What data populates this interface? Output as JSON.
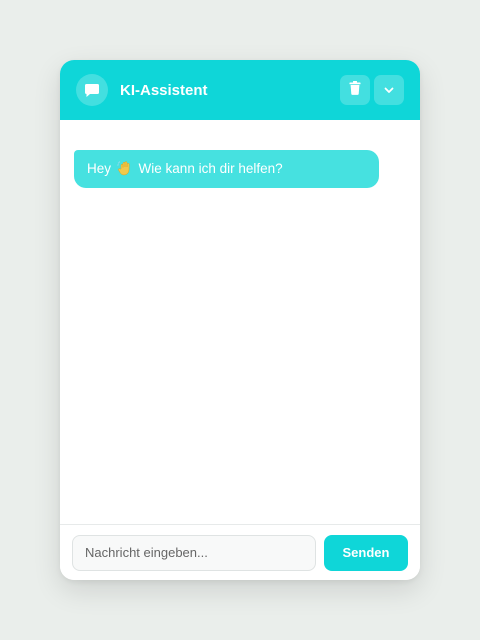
{
  "header": {
    "title": "KI-Assistent",
    "avatar_icon": "chat-bubble-icon",
    "delete_icon": "trash-icon",
    "minimize_icon": "chevron-down-icon"
  },
  "messages": [
    {
      "sender": "assistant",
      "text_before": "Hey",
      "emoji": "waving-hand-icon",
      "text_after": "Wie kann ich dir helfen?"
    }
  ],
  "composer": {
    "placeholder": "Nachricht eingeben...",
    "value": "",
    "send_label": "Senden"
  },
  "colors": {
    "accent": "#0fd6d8",
    "bubble": "#46e1e0",
    "background": "#eaeeeb"
  }
}
